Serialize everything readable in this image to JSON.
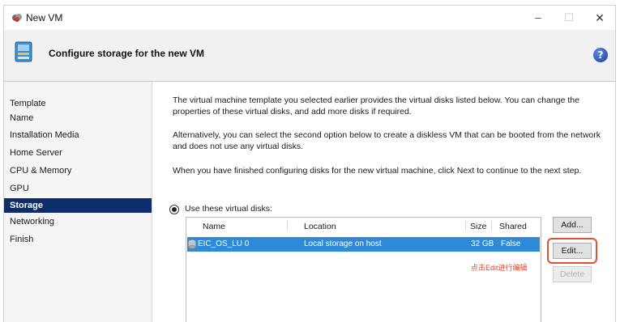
{
  "window": {
    "title": "New VM",
    "controls": {
      "minimize": "–",
      "maximize": "☐",
      "close": "✕"
    }
  },
  "banner": {
    "title": "Configure storage for the new VM",
    "help": "?"
  },
  "nav": {
    "items": [
      {
        "label": "Template",
        "selected": false
      },
      {
        "label": "Name",
        "selected": false
      },
      {
        "label": "Installation Media",
        "selected": false
      },
      {
        "label": "Home Server",
        "selected": false
      },
      {
        "label": "CPU & Memory",
        "selected": false
      },
      {
        "label": "GPU",
        "selected": false
      },
      {
        "label": "Storage",
        "selected": true
      },
      {
        "label": "Networking",
        "selected": false
      },
      {
        "label": "Finish",
        "selected": false
      }
    ]
  },
  "content": {
    "para1": "The virtual machine template you selected earlier provides the virtual disks listed below. You can change the properties of these virtual disks, and add more disks if required.",
    "para2": "Alternatively, you can select the second option below to create a diskless VM that can be booted from the network and does not use any virtual disks.",
    "para3": "When you have finished configuring disks for the new virtual machine, click Next to continue to the next step.",
    "radio_label": "Use these virtual disks:",
    "columns": {
      "name": "Name",
      "location": "Location",
      "size": "Size",
      "shared": "Shared"
    },
    "disks": [
      {
        "name": "EIC_OS_LU 0",
        "location": "Local storage on host",
        "size": "32 GB",
        "shared": "False"
      }
    ],
    "buttons": {
      "add": "Add...",
      "edit": "Edit...",
      "delete": "Delete"
    },
    "annotation": "点击Edit进行编辑"
  },
  "colors": {
    "selection": "#2e8ad8",
    "nav_selected": "#0d2e6b",
    "highlight": "#e0522e"
  }
}
